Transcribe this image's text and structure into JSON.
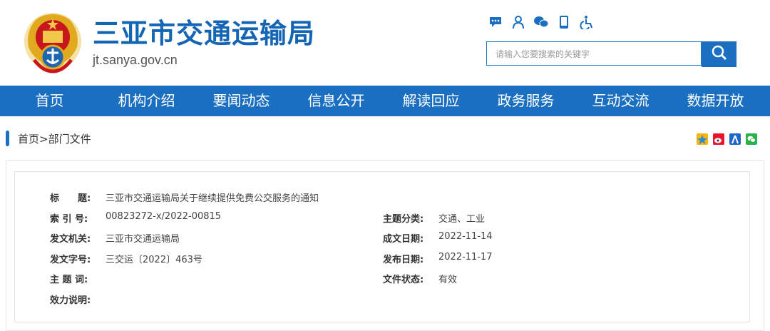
{
  "header": {
    "title": "三亚市交通运输局",
    "domain": "jt.sanya.gov.cn",
    "top_icons": [
      "message-icon",
      "user-icon",
      "wechat-icon",
      "mobile-icon",
      "accessibility-icon"
    ],
    "search_placeholder": "请输入您要搜索的关键字",
    "brand_color": "#1a6fc0"
  },
  "nav": {
    "items": [
      "首页",
      "机构介绍",
      "要闻动态",
      "信息公开",
      "解读回应",
      "政务服务",
      "互动交流",
      "数据开放"
    ]
  },
  "breadcrumb": "首页>部门文件",
  "share_icons": [
    "qzone-icon",
    "weibo-icon",
    "renren-icon",
    "wechat-share-icon"
  ],
  "info": {
    "title_label": "标　　题:",
    "title_value": "三亚市交通运输局关于继续提供免费公交服务的通知",
    "index_label": "索 引 号:",
    "index_value": "00823272-x/2022-00815",
    "topic_label": "主题分类:",
    "topic_value": "交通、工业",
    "org_label": "发文机关:",
    "org_value": "三亚市交通运输局",
    "written_label": "成文日期:",
    "written_value": "2022-11-14",
    "docno_label": "发文字号:",
    "docno_value": "三交运〔2022〕463号",
    "published_label": "发布日期:",
    "published_value": "2022-11-17",
    "keywords_label": "主 题 词:",
    "keywords_value": "",
    "status_label": "文件状态:",
    "status_value": "有效",
    "validity_label": "效力说明:",
    "validity_value": ""
  }
}
